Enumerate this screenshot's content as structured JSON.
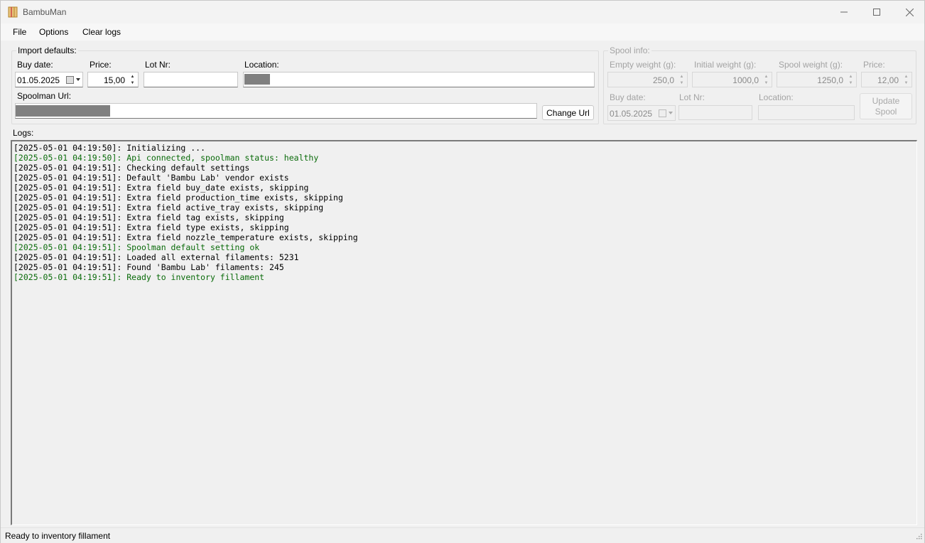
{
  "window": {
    "title": "BambuMan",
    "icon": "spool-icon"
  },
  "menu": {
    "file": "File",
    "options": "Options",
    "clear_logs": "Clear logs"
  },
  "import_defaults": {
    "legend": "Import defaults:",
    "buy_date_label": "Buy date:",
    "buy_date_value": "01.05.2025",
    "price_label": "Price:",
    "price_value": "15,00",
    "lot_label": "Lot Nr:",
    "lot_value": "",
    "location_label": "Location:",
    "spoolman_url_label": "Spoolman Url:",
    "change_url_button": "Change Url"
  },
  "spool_info": {
    "legend": "Spool info:",
    "empty_weight_label": "Empty weight (g):",
    "empty_weight_value": "250,0",
    "initial_weight_label": "Initial weight (g):",
    "initial_weight_value": "1000,0",
    "spool_weight_label": "Spool weight (g):",
    "spool_weight_value": "1250,0",
    "price_label": "Price:",
    "price_value": "12,00",
    "buy_date_label": "Buy date:",
    "buy_date_value": "01.05.2025",
    "lot_label": "Lot Nr:",
    "lot_value": "",
    "location_label": "Location:",
    "location_value": "",
    "update_button_line1": "Update",
    "update_button_line2": "Spool"
  },
  "logs": {
    "label": "Logs:",
    "lines": [
      {
        "text": "[2025-05-01 04:19:50]: Initializing ...",
        "status": "info"
      },
      {
        "text": "[2025-05-01 04:19:50]: Api connected, spoolman status: healthy",
        "status": "ok"
      },
      {
        "text": "[2025-05-01 04:19:51]: Checking default settings",
        "status": "info"
      },
      {
        "text": "[2025-05-01 04:19:51]: Default 'Bambu Lab' vendor exists",
        "status": "info"
      },
      {
        "text": "[2025-05-01 04:19:51]: Extra field buy_date exists, skipping",
        "status": "info"
      },
      {
        "text": "[2025-05-01 04:19:51]: Extra field production_time exists, skipping",
        "status": "info"
      },
      {
        "text": "[2025-05-01 04:19:51]: Extra field active_tray exists, skipping",
        "status": "info"
      },
      {
        "text": "[2025-05-01 04:19:51]: Extra field tag exists, skipping",
        "status": "info"
      },
      {
        "text": "[2025-05-01 04:19:51]: Extra field type exists, skipping",
        "status": "info"
      },
      {
        "text": "[2025-05-01 04:19:51]: Extra field nozzle_temperature exists, skipping",
        "status": "info"
      },
      {
        "text": "[2025-05-01 04:19:51]: Spoolman default setting ok",
        "status": "ok"
      },
      {
        "text": "[2025-05-01 04:19:51]: Loaded all external filaments: 5231",
        "status": "info"
      },
      {
        "text": "[2025-05-01 04:19:51]: Found 'Bambu Lab' filaments: 245",
        "status": "info"
      },
      {
        "text": "[2025-05-01 04:19:51]: Ready to inventory fillament",
        "status": "ok"
      }
    ]
  },
  "status_bar": {
    "text": "Ready to inventory fillament"
  },
  "colors": {
    "log_ok": "#0a6b0a",
    "masked": "#808080"
  }
}
